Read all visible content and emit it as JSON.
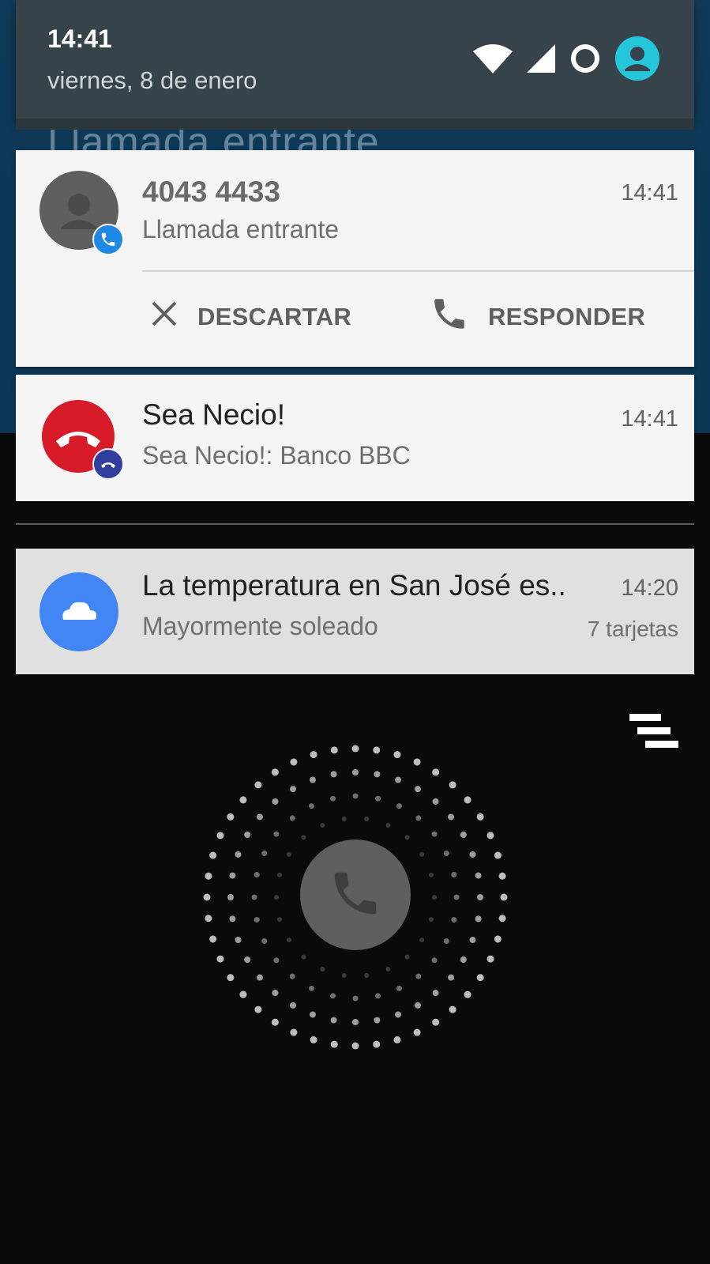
{
  "status": {
    "time": "14:41",
    "date": "viernes, 8 de enero",
    "icons": [
      "wifi-icon",
      "cell-signal-icon",
      "battery-ring-icon",
      "user-account-icon"
    ]
  },
  "background": {
    "ghost_title": "Llamada entrante",
    "accent_color": "#0b3553"
  },
  "notifications": [
    {
      "title": "4043 4433",
      "subtitle": "Llamada entrante",
      "time": "14:41",
      "icon": "person-avatar-icon",
      "badge_icon": "phone-icon",
      "actions": [
        {
          "label": "DESCARTAR",
          "icon": "close-icon"
        },
        {
          "label": "RESPONDER",
          "icon": "phone-icon"
        }
      ]
    },
    {
      "title": "Sea Necio!",
      "subtitle_app": "Sea Necio!:",
      "subtitle_text": "Banco BBC",
      "time": "14:41",
      "icon": "hang-up-icon",
      "badge_icon": "hang-up-icon",
      "brand_color": "#d81b28"
    },
    {
      "title": "La temperatura en San José es..",
      "subtitle": "Mayormente soleado",
      "time": "14:20",
      "extra": "7 tarjetas",
      "icon": "cloud-icon",
      "brand_color": "#4285f4"
    }
  ],
  "call_screen": {
    "answer_icon": "phone-icon",
    "more_icon": "stack-icon"
  }
}
